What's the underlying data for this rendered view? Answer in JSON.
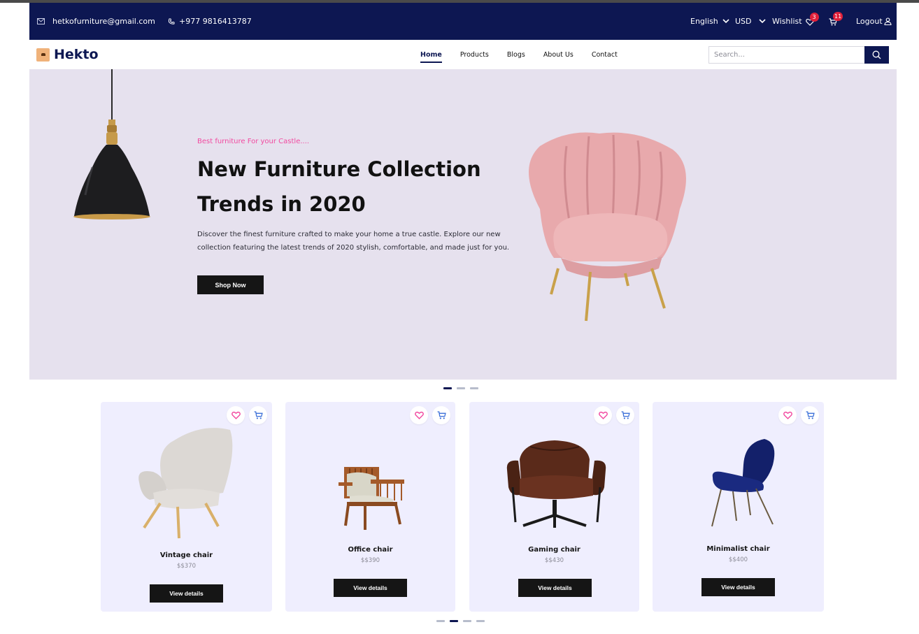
{
  "topbar": {
    "email": "hetkofurniture@gmail.com",
    "phone": "+977 9816413787",
    "language": "English",
    "currency": "USD",
    "wishlist_label": "Wishlist",
    "wishlist_count": "3",
    "cart_count": "11",
    "logout_label": "Logout"
  },
  "nav": {
    "brand": "Hekto",
    "links": [
      "Home",
      "Products",
      "Blogs",
      "About Us",
      "Contact"
    ],
    "active": "Home",
    "search_placeholder": "Search..."
  },
  "hero": {
    "subtitle": "Best furniture For your Castle....",
    "title": "New Furniture Collection Trends in 2020",
    "description": "Discover the finest furniture crafted to make your home a true castle. Explore our new collection featuring the latest trends of 2020 stylish, comfortable, and made just for you.",
    "cta": "Shop Now",
    "slides": 3,
    "active_slide": 1
  },
  "products": [
    {
      "name": "Vintage chair",
      "price": "$$370",
      "cta": "View details"
    },
    {
      "name": "Office chair",
      "price": "$$390",
      "cta": "View details"
    },
    {
      "name": "Gaming chair",
      "price": "$$430",
      "cta": "View details"
    },
    {
      "name": "Minimalist chair",
      "price": "$$400",
      "cta": "View details"
    }
  ],
  "product_slider": {
    "pages": 4,
    "active_page": 2
  },
  "colors": {
    "navy": "#0d1752",
    "accent_pink": "#f24aa0",
    "badge_red": "#e0203a",
    "hero_bg": "#e6e1ee",
    "card_bg": "#efeefe",
    "button_dark": "#151515"
  }
}
